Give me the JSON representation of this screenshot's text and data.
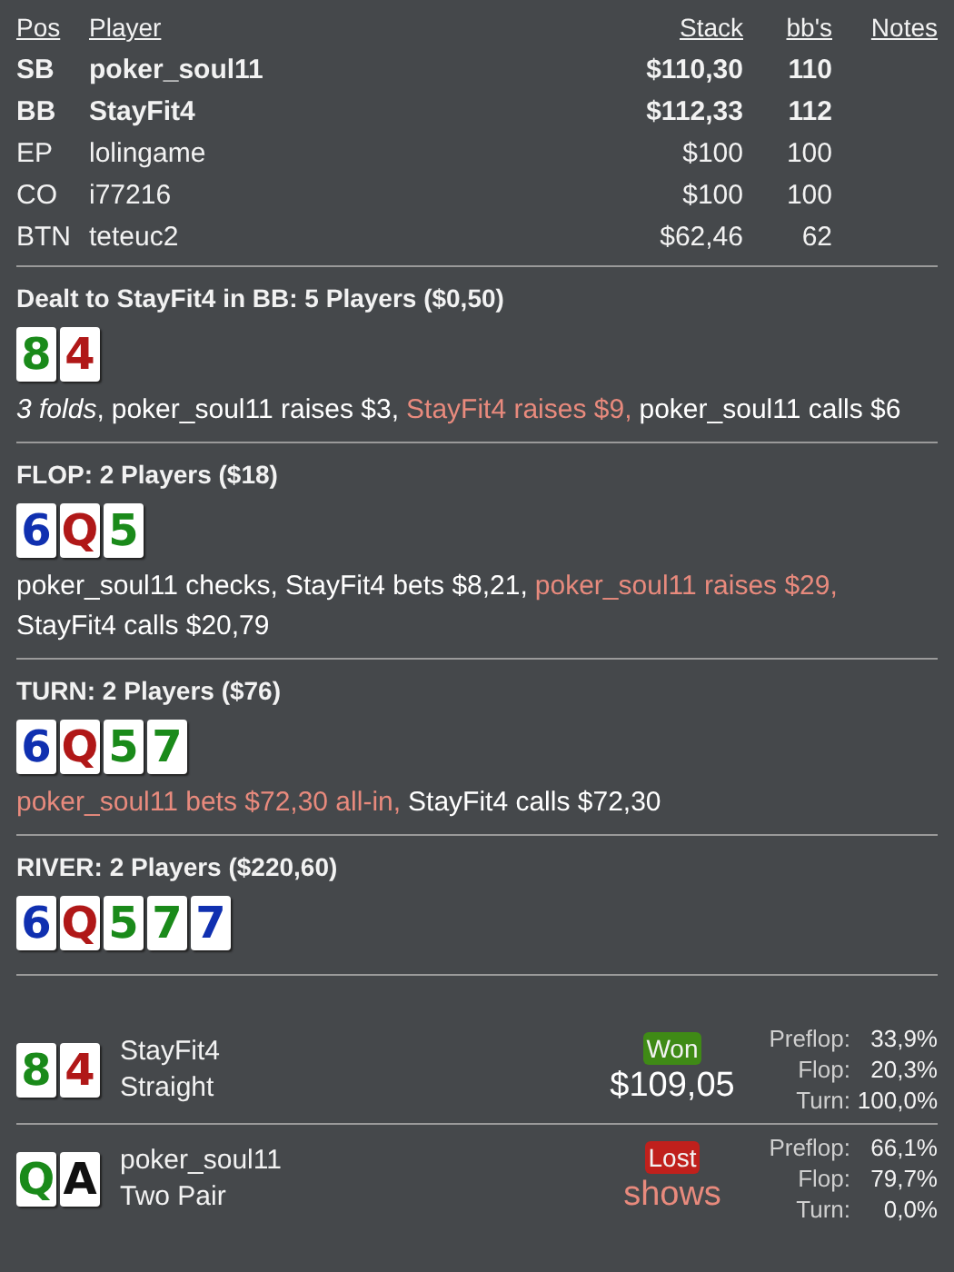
{
  "players": {
    "columns": [
      "Pos",
      "Player",
      "Stack",
      "bb's",
      "Notes"
    ],
    "rows": [
      {
        "pos": "SB",
        "player": "poker_soul11",
        "stack": "$110,30",
        "bbs": "110",
        "bold": true
      },
      {
        "pos": "BB",
        "player": "StayFit4",
        "stack": "$112,33",
        "bbs": "112",
        "bold": true
      },
      {
        "pos": "EP",
        "player": "lolingame",
        "stack": "$100",
        "bbs": "100",
        "bold": false
      },
      {
        "pos": "CO",
        "player": "i77216",
        "stack": "$100",
        "bbs": "100",
        "bold": false
      },
      {
        "pos": "BTN",
        "player": "teteuc2",
        "stack": "$62,46",
        "bbs": "62",
        "bold": false
      }
    ]
  },
  "streets": [
    {
      "title": "Dealt to StayFit4 in BB: 5 Players ($0,50)",
      "cards": [
        {
          "rank": "8",
          "color": "#1a8a1a"
        },
        {
          "rank": "4",
          "color": "#b01818"
        }
      ],
      "actions": [
        {
          "text": "*3 folds*,",
          "highlighted": false
        },
        {
          "text": "poker_soul11 raises $3,",
          "highlighted": false
        },
        {
          "text": "StayFit4 raises $9,",
          "highlighted": true
        },
        {
          "text": "poker_soul11 calls $6",
          "highlighted": false
        }
      ]
    },
    {
      "title": "FLOP: 2 Players ($18)",
      "cards": [
        {
          "rank": "6",
          "color": "#1030b0"
        },
        {
          "rank": "Q",
          "color": "#b01818"
        },
        {
          "rank": "5",
          "color": "#1a8a1a"
        }
      ],
      "actions": [
        {
          "text": "poker_soul11 checks,",
          "highlighted": false
        },
        {
          "text": "StayFit4 bets $8,21,",
          "highlighted": false
        },
        {
          "text": "poker_soul11 raises $29,",
          "highlighted": true
        },
        {
          "text": "StayFit4 calls $20,79",
          "highlighted": false
        }
      ]
    },
    {
      "title": "TURN: 2 Players ($76)",
      "cards": [
        {
          "rank": "6",
          "color": "#1030b0"
        },
        {
          "rank": "Q",
          "color": "#b01818"
        },
        {
          "rank": "5",
          "color": "#1a8a1a"
        },
        {
          "rank": "7",
          "color": "#1a8a1a"
        }
      ],
      "actions": [
        {
          "text": "poker_soul11 bets $72,30 all-in,",
          "highlighted": true
        },
        {
          "text": "StayFit4 calls $72,30",
          "highlighted": false
        }
      ]
    },
    {
      "title": "RIVER: 2 Players ($220,60)",
      "cards": [
        {
          "rank": "6",
          "color": "#1030b0"
        },
        {
          "rank": "Q",
          "color": "#b01818"
        },
        {
          "rank": "5",
          "color": "#1a8a1a"
        },
        {
          "rank": "7",
          "color": "#1a8a1a"
        },
        {
          "rank": "7",
          "color": "#1030b0"
        }
      ]
    }
  ],
  "results": [
    {
      "cards": [
        {
          "rank": "8",
          "color": "#1a8a1a"
        },
        {
          "rank": "4",
          "color": "#b01818"
        }
      ],
      "player": "StayFit4",
      "hand": "Straight",
      "won": true,
      "badge": "Won",
      "amount": "$109,05",
      "equity": [
        {
          "label": "Preflop:",
          "value": "33,9%"
        },
        {
          "label": "Flop:",
          "value": "20,3%"
        },
        {
          "label": "Turn:",
          "value": "100,0%"
        }
      ]
    },
    {
      "cards": [
        {
          "rank": "Q",
          "color": "#1a8a1a"
        },
        {
          "rank": "A",
          "color": "#111111"
        }
      ],
      "player": "poker_soul11",
      "hand": "Two Pair",
      "won": false,
      "badge": "Lost",
      "amount": "shows",
      "equity": [
        {
          "label": "Preflop:",
          "value": "66,1%"
        },
        {
          "label": "Flop:",
          "value": "79,7%"
        },
        {
          "label": "Turn:",
          "value": "0,0%"
        }
      ]
    }
  ]
}
